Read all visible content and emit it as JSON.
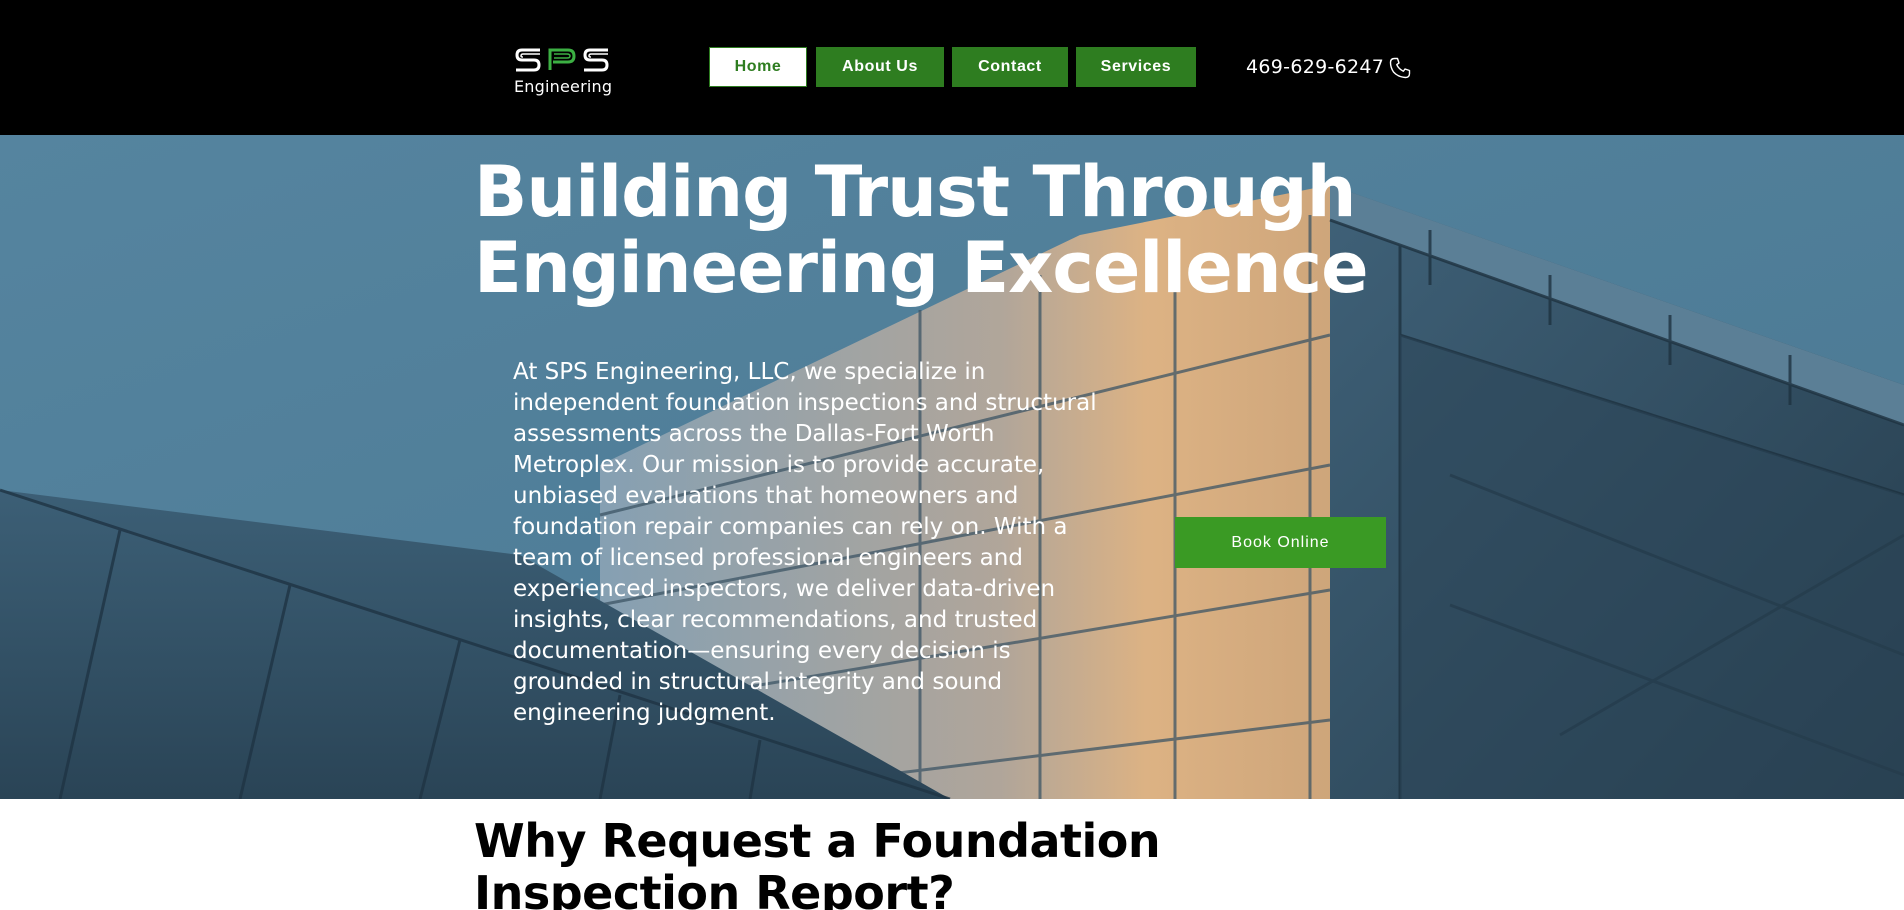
{
  "header": {
    "logo": {
      "mark": "SPS",
      "text": "Engineering"
    },
    "nav": [
      {
        "label": "Home",
        "active": true
      },
      {
        "label": "About Us",
        "active": false
      },
      {
        "label": "Contact",
        "active": false
      },
      {
        "label": "Services",
        "active": false
      }
    ],
    "phone": "469-629-6247",
    "phone_icon": "phone-icon"
  },
  "hero": {
    "title_line1": "Building Trust Through",
    "title_line2": "Engineering Excellence",
    "description": "At SPS Engineering, LLC, we specialize in independent foundation inspections and structural assessments across the Dallas-Fort  Worth Metroplex. Our mission is to provide  accurate, unbiased evaluations that homeowners  and foundation repair companies can rely on. With  a team of licensed professional engineers and experienced inspectors, we deliver data-driven insights, clear recommendations, and trusted documentation—ensuring every decision is grounded in structural integrity and sound engineering judgment.",
    "book_button": "Book Online"
  },
  "section": {
    "title_line1": "Why Request a Foundation",
    "title_line2": "Inspection Report?"
  },
  "colors": {
    "header_bg": "#000000",
    "brand_green": "#2e7d20",
    "button_green": "#3a9a24",
    "sky": "#4e7d98"
  }
}
